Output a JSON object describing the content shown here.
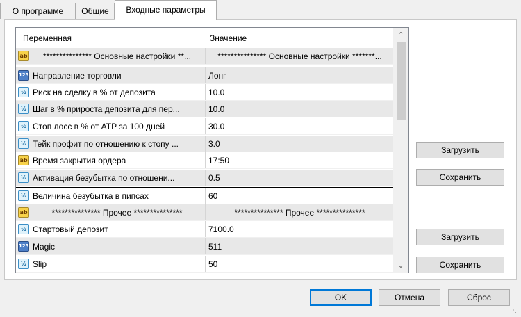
{
  "tabs": [
    {
      "label": "О программе"
    },
    {
      "label": "Общие"
    },
    {
      "label": "Входные параметры",
      "active": true
    }
  ],
  "grid": {
    "col_variable": "Переменная",
    "col_value": "Значение",
    "rows": [
      {
        "icon": "string-type-icon",
        "name": "*************** Основные настройки **...",
        "value": "*************** Основные настройки *******..."
      },
      {
        "icon": "integer-type-icon",
        "name": "Направление торговли",
        "value": "Лонг"
      },
      {
        "icon": "double-type-icon",
        "name": "Риск на сделку в % от депозита",
        "value": "10.0"
      },
      {
        "icon": "double-type-icon",
        "name": "Шаг в % прироста депозита для пер...",
        "value": "10.0"
      },
      {
        "icon": "double-type-icon",
        "name": "Стоп лосс в % от ATP за 100 дней",
        "value": "30.0"
      },
      {
        "icon": "double-type-icon",
        "name": "Тейк профит по отношению к стопу ...",
        "value": "3.0"
      },
      {
        "icon": "string-type-icon",
        "name": "Время закрытия ордера",
        "value": "17:50"
      },
      {
        "icon": "double-type-icon",
        "name": "Активация безубытка по отношени...",
        "value": "0.5"
      },
      {
        "icon": "double-type-icon",
        "name": "Величина безубытка в пипсах",
        "value": "60"
      },
      {
        "icon": "string-type-icon",
        "name": "*************** Прочее ***************",
        "value": "*************** Прочее ***************"
      },
      {
        "icon": "double-type-icon",
        "name": "Стартовый депозит",
        "value": "7100.0"
      },
      {
        "icon": "integer-type-icon",
        "name": "Magic",
        "value": "511"
      },
      {
        "icon": "double-type-icon",
        "name": "Slip",
        "value": "50"
      }
    ],
    "icon_text": {
      "string": "ab",
      "integer": "123",
      "double": "½"
    }
  },
  "buttons": {
    "load_1": "Загрузить",
    "save_1": "Сохранить",
    "load_2": "Загрузить",
    "save_2": "Сохранить",
    "ok": "OK",
    "cancel": "Отмена",
    "reset": "Сброс"
  }
}
